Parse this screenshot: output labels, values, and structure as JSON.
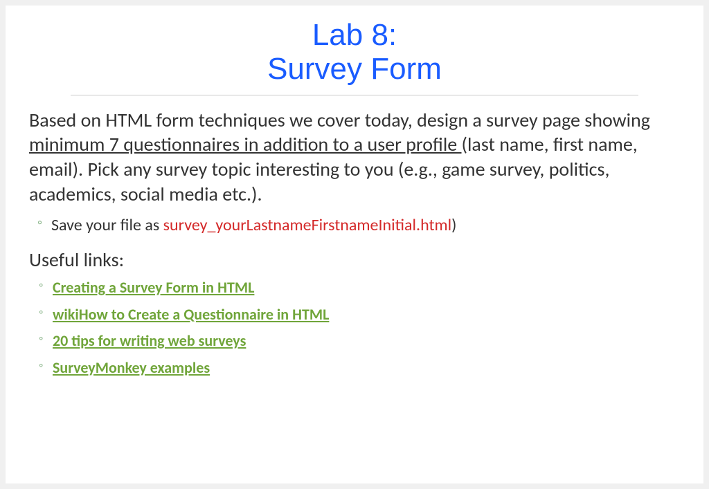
{
  "title": {
    "line1": "Lab 8:",
    "line2": "Survey Form"
  },
  "intro": {
    "pre": "Based on HTML form techniques we cover today, design a survey page showing ",
    "underlined": "minimum 7 questionnaires in addition to a user profile ",
    "post": "(last name, first name, email). Pick any survey topic interesting to you (e.g., game survey, politics, academics, social media etc.)."
  },
  "save_instruction": {
    "prefix": "Save your file as ",
    "filename": "survey_yourLastnameFirstnameInitial.html",
    "suffix": ")"
  },
  "useful_heading": "Useful links:",
  "links": [
    "Creating a Survey Form in HTML",
    "wikiHow to Create a Questionnaire in HTML",
    "20 tips for writing web surveys",
    "SurveyMonkey examples"
  ]
}
